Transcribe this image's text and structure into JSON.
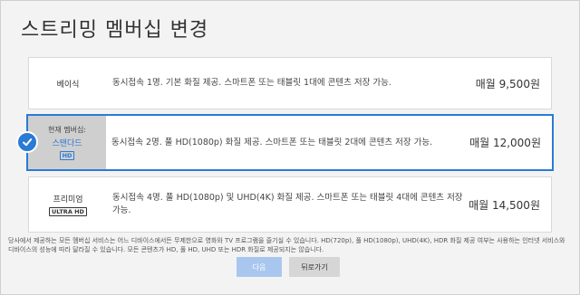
{
  "dialog": {
    "title": "스트리밍 멤버십 변경"
  },
  "plans": [
    {
      "name": "베이식",
      "description": "동시접속 1명. 기본 화질 제공. 스마트폰 또는 태블릿 1대에 콘텐츠 저장 가능.",
      "price": "매월 9,500원"
    },
    {
      "current_label": "현재 멤버십:",
      "name": "스탠다드",
      "badge": "HD",
      "description": "동시접속 2명. 풀 HD(1080p) 화질 제공. 스마트폰 또는 태블릿 2대에 콘텐츠 저장 가능.",
      "price": "매월 12,000원",
      "selected": true
    },
    {
      "name": "프리미엄",
      "badge": "ULTRA HD",
      "description": "동시접속 4명. 풀 HD(1080p) 및 UHD(4K) 화질 제공. 스마트폰 또는 태블릿 4대에 콘텐츠 저장 가능.",
      "price": "매월 14,500원"
    }
  ],
  "footnote": "당사에서 제공하는 모든 멤버십 서비스는 어느 디바이스에서든 무제한으로 영화와 TV 프로그램을 즐기실 수 있습니다. HD(720p), 풀 HD(1080p), UHD(4K), HDR 화질 제공 여부는 사용하는 인터넷 서비스와 디바이스의 성능에 따라 달라질 수 있습니다. 모든 콘텐츠가 HD, 풀 HD, UHD 또는 HDR 화질로 제공되지는 않습니다.",
  "buttons": {
    "next": "다음",
    "back": "뒤로가기"
  },
  "colors": {
    "accent": "#2b7ad6",
    "next_button": "#a9c7ee"
  },
  "icons": {
    "selected": "checkmark-icon"
  }
}
